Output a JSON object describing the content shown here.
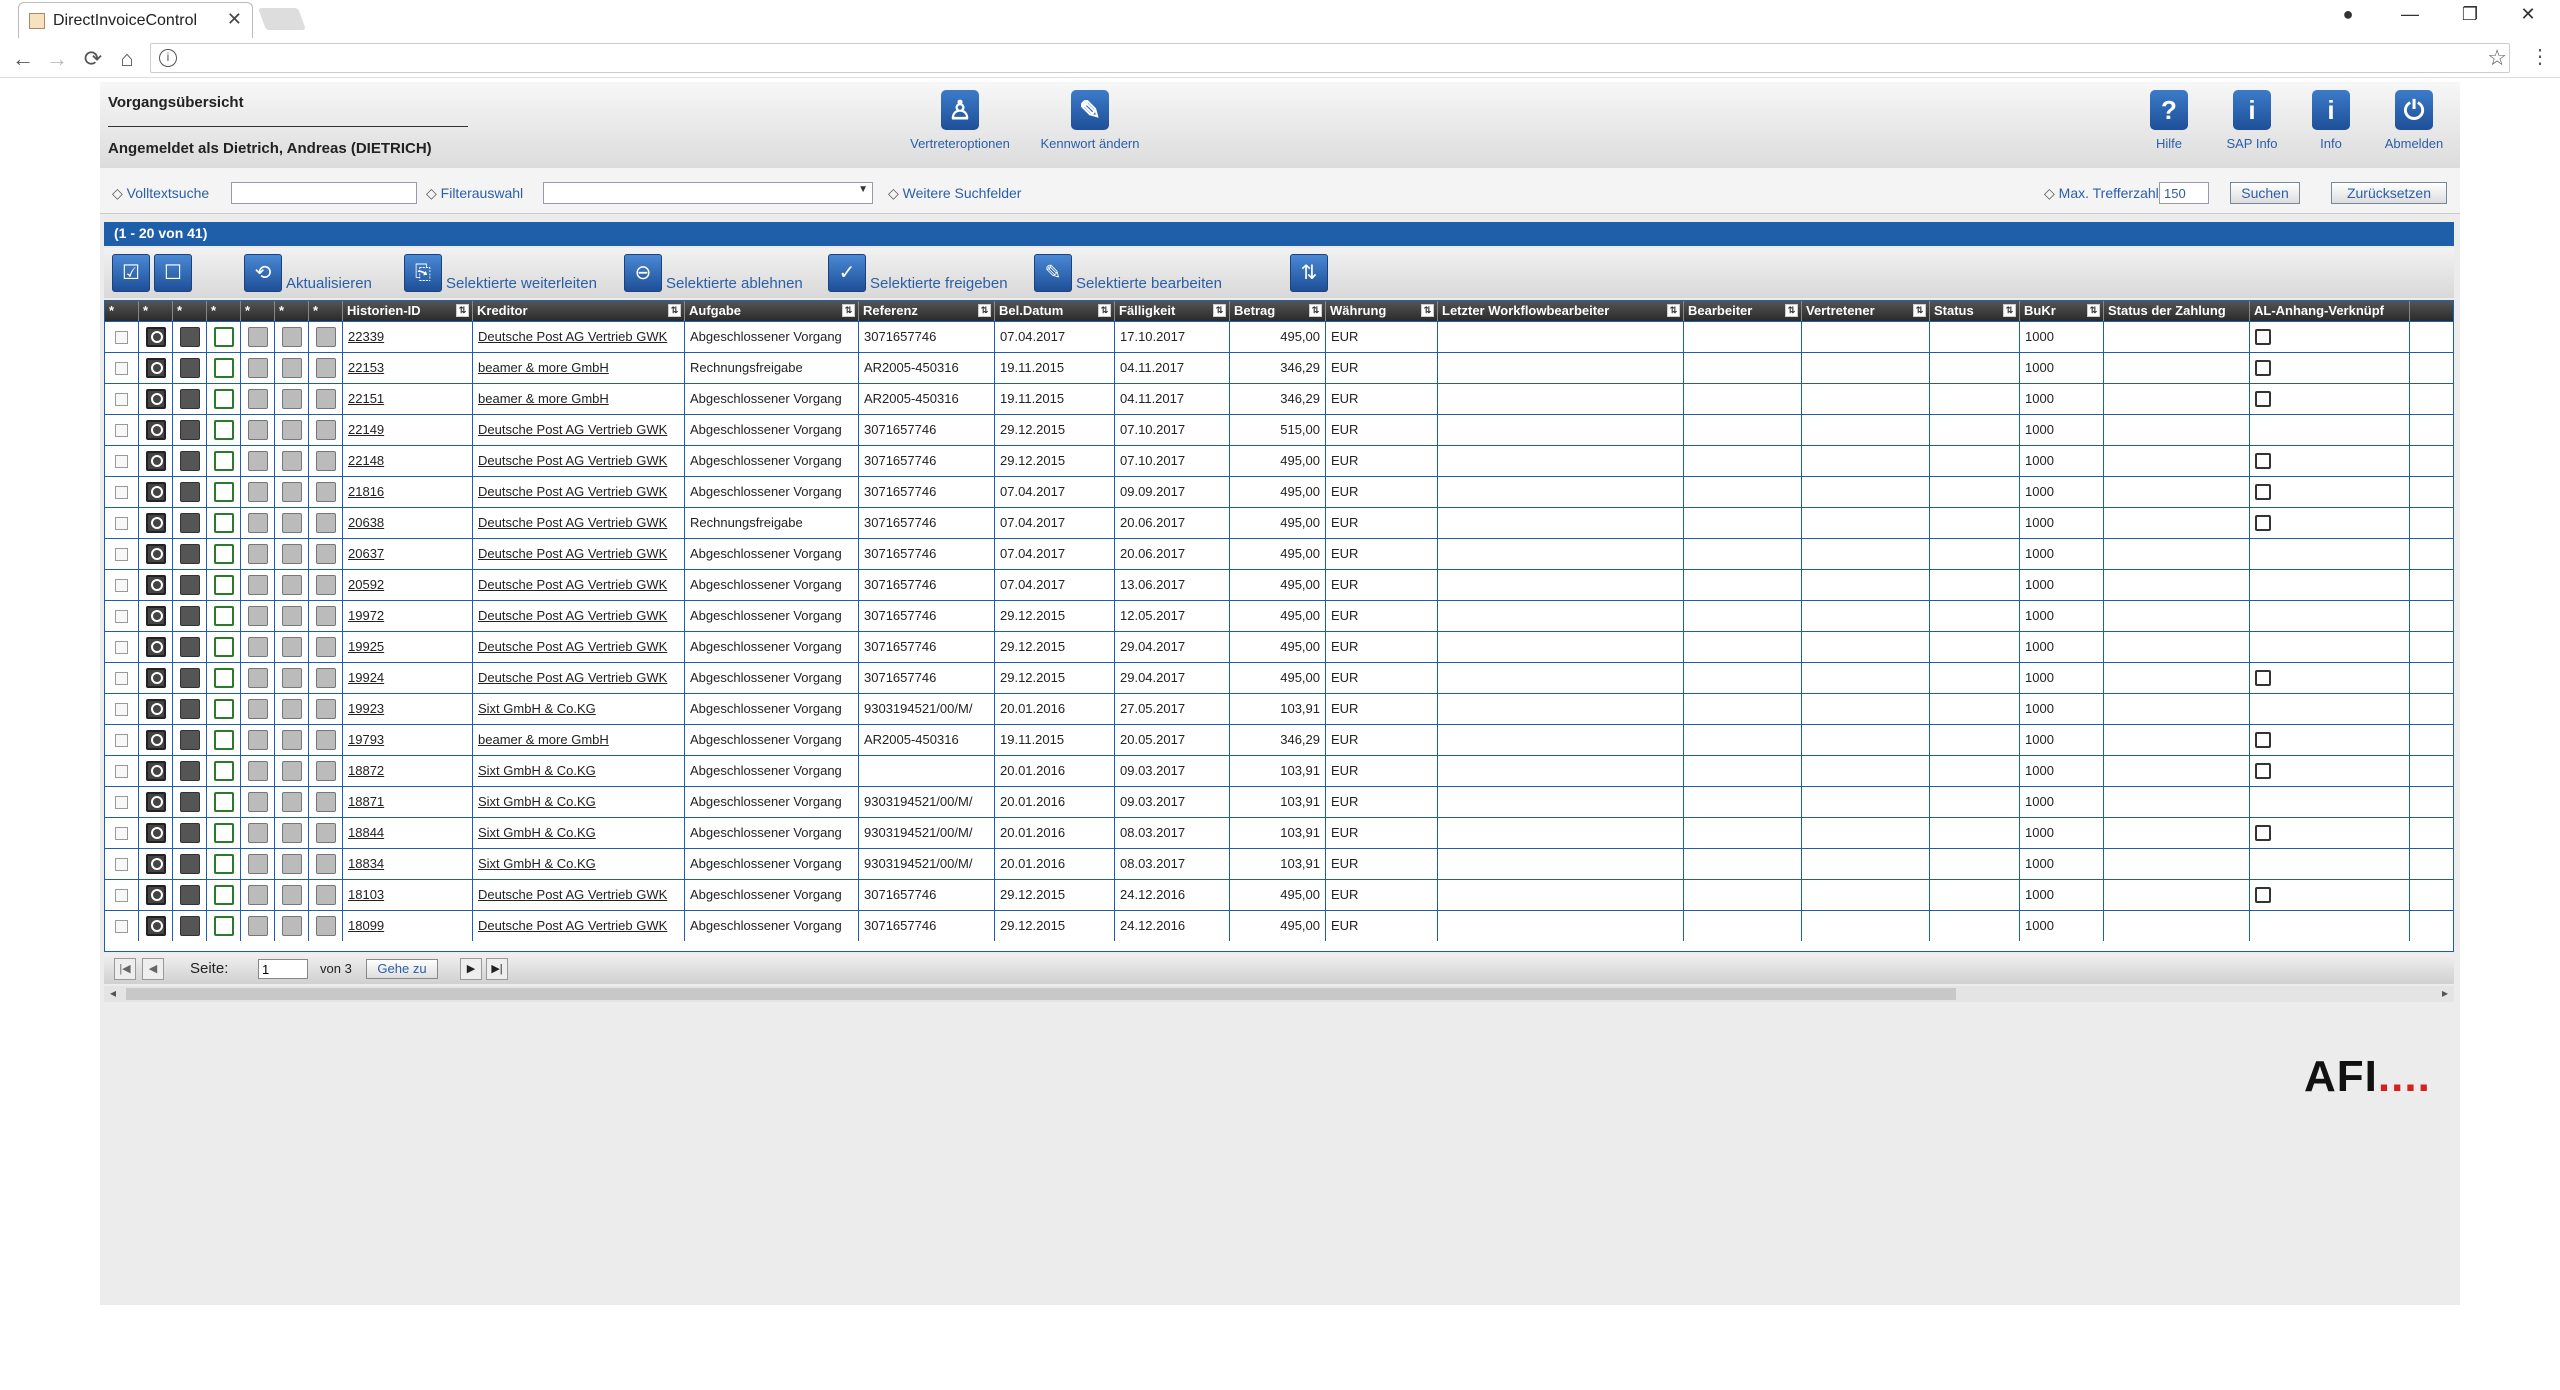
{
  "browser": {
    "tab_title": "DirectInvoiceControl",
    "tab_close": "✕",
    "nav": {
      "back": "←",
      "forward": "→",
      "reload": "⟳",
      "home": "⌂",
      "info": "i",
      "star": "☆",
      "menu": "⋮"
    },
    "window": {
      "profile": "●",
      "minimize": "—",
      "restore": "❐",
      "close": "✕"
    }
  },
  "header": {
    "title": "Vorgangsübersicht",
    "user": "Angemeldet als Dietrich, Andreas (DIETRICH)",
    "buttons": [
      {
        "label": "Vertreteroptionen",
        "icon": "person-icon",
        "glyph": "♙"
      },
      {
        "label": "Kennwort ändern",
        "icon": "key-pencil-icon",
        "glyph": "✎"
      },
      {
        "label": "Hilfe",
        "icon": "help-icon",
        "glyph": "?"
      },
      {
        "label": "SAP Info",
        "icon": "info-icon",
        "glyph": "i"
      },
      {
        "label": "Info",
        "icon": "info-icon",
        "glyph": "i"
      },
      {
        "label": "Abmelden",
        "icon": "power-icon",
        "glyph": "⏻"
      }
    ]
  },
  "search": {
    "fulltext_label": "Volltextsuche",
    "fulltext_value": "",
    "filter_label": "Filterauswahl",
    "filter_value": "",
    "more_label": "Weitere Suchfelder",
    "max_label": "Max. Trefferzahl",
    "max_value": "150",
    "search_btn": "Suchen",
    "reset_btn": "Zurücksetzen"
  },
  "count": "(1 - 20 von 41)",
  "toolbar": {
    "select_all_glyph": "☑",
    "deselect_glyph": "☐",
    "refresh": "Aktualisieren",
    "forward": "Selektierte weiterleiten",
    "reject": "Selektierte ablehnen",
    "release": "Selektierte freigeben",
    "edit": "Selektierte bearbeiten",
    "refresh_glyph": "⟲",
    "forward_glyph": "⎘",
    "reject_glyph": "⊖",
    "release_glyph": "✓",
    "edit_glyph": "✎",
    "extra_glyph": "⇅"
  },
  "columns": [
    "*",
    "*",
    "*",
    "*",
    "*",
    "*",
    "*",
    "Historien-ID",
    "Kreditor",
    "Aufgabe",
    "Referenz",
    "Bel.Datum",
    "Fälligkeit",
    "Betrag",
    "Währung",
    "Letzter Workflowbearbeiter",
    "Bearbeiter",
    "Vertretener",
    "Status",
    "BuKr",
    "Status der Zahlung",
    "AL-Anhang-Verknüpf"
  ],
  "rows": [
    {
      "id": "22339",
      "kreditor": "Deutsche Post AG Vertrieb GWK",
      "aufgabe": "Abgeschlossener Vorgang",
      "referenz": "3071657746",
      "bel": "07.04.2017",
      "faell": "17.10.2017",
      "betrag": "495,00",
      "waehrung": "EUR",
      "bukr": "1000",
      "anhang": true
    },
    {
      "id": "22153",
      "kreditor": "beamer & more GmbH",
      "aufgabe": "Rechnungsfreigabe",
      "referenz": "AR2005-450316",
      "bel": "19.11.2015",
      "faell": "04.11.2017",
      "betrag": "346,29",
      "waehrung": "EUR",
      "bukr": "1000",
      "anhang": true
    },
    {
      "id": "22151",
      "kreditor": "beamer & more GmbH",
      "aufgabe": "Abgeschlossener Vorgang",
      "referenz": "AR2005-450316",
      "bel": "19.11.2015",
      "faell": "04.11.2017",
      "betrag": "346,29",
      "waehrung": "EUR",
      "bukr": "1000",
      "anhang": true
    },
    {
      "id": "22149",
      "kreditor": "Deutsche Post AG Vertrieb GWK",
      "aufgabe": "Abgeschlossener Vorgang",
      "referenz": "3071657746",
      "bel": "29.12.2015",
      "faell": "07.10.2017",
      "betrag": "515,00",
      "waehrung": "EUR",
      "bukr": "1000",
      "anhang": false
    },
    {
      "id": "22148",
      "kreditor": "Deutsche Post AG Vertrieb GWK",
      "aufgabe": "Abgeschlossener Vorgang",
      "referenz": "3071657746",
      "bel": "29.12.2015",
      "faell": "07.10.2017",
      "betrag": "495,00",
      "waehrung": "EUR",
      "bukr": "1000",
      "anhang": true
    },
    {
      "id": "21816",
      "kreditor": "Deutsche Post AG Vertrieb GWK",
      "aufgabe": "Abgeschlossener Vorgang",
      "referenz": "3071657746",
      "bel": "07.04.2017",
      "faell": "09.09.2017",
      "betrag": "495,00",
      "waehrung": "EUR",
      "bukr": "1000",
      "anhang": true
    },
    {
      "id": "20638",
      "kreditor": "Deutsche Post AG Vertrieb GWK",
      "aufgabe": "Rechnungsfreigabe",
      "referenz": "3071657746",
      "bel": "07.04.2017",
      "faell": "20.06.2017",
      "betrag": "495,00",
      "waehrung": "EUR",
      "bukr": "1000",
      "anhang": true
    },
    {
      "id": "20637",
      "kreditor": "Deutsche Post AG Vertrieb GWK",
      "aufgabe": "Abgeschlossener Vorgang",
      "referenz": "3071657746",
      "bel": "07.04.2017",
      "faell": "20.06.2017",
      "betrag": "495,00",
      "waehrung": "EUR",
      "bukr": "1000",
      "anhang": false
    },
    {
      "id": "20592",
      "kreditor": "Deutsche Post AG Vertrieb GWK",
      "aufgabe": "Abgeschlossener Vorgang",
      "referenz": "3071657746",
      "bel": "07.04.2017",
      "faell": "13.06.2017",
      "betrag": "495,00",
      "waehrung": "EUR",
      "bukr": "1000",
      "anhang": false
    },
    {
      "id": "19972",
      "kreditor": "Deutsche Post AG Vertrieb GWK",
      "aufgabe": "Abgeschlossener Vorgang",
      "referenz": "3071657746",
      "bel": "29.12.2015",
      "faell": "12.05.2017",
      "betrag": "495,00",
      "waehrung": "EUR",
      "bukr": "1000",
      "anhang": false
    },
    {
      "id": "19925",
      "kreditor": "Deutsche Post AG Vertrieb GWK",
      "aufgabe": "Abgeschlossener Vorgang",
      "referenz": "3071657746",
      "bel": "29.12.2015",
      "faell": "29.04.2017",
      "betrag": "495,00",
      "waehrung": "EUR",
      "bukr": "1000",
      "anhang": false
    },
    {
      "id": "19924",
      "kreditor": "Deutsche Post AG Vertrieb GWK",
      "aufgabe": "Abgeschlossener Vorgang",
      "referenz": "3071657746",
      "bel": "29.12.2015",
      "faell": "29.04.2017",
      "betrag": "495,00",
      "waehrung": "EUR",
      "bukr": "1000",
      "anhang": true
    },
    {
      "id": "19923",
      "kreditor": "Sixt GmbH & Co.KG",
      "aufgabe": "Abgeschlossener Vorgang",
      "referenz": "9303194521/00/M/",
      "bel": "20.01.2016",
      "faell": "27.05.2017",
      "betrag": "103,91",
      "waehrung": "EUR",
      "bukr": "1000",
      "anhang": false
    },
    {
      "id": "19793",
      "kreditor": "beamer & more GmbH",
      "aufgabe": "Abgeschlossener Vorgang",
      "referenz": "AR2005-450316",
      "bel": "19.11.2015",
      "faell": "20.05.2017",
      "betrag": "346,29",
      "waehrung": "EUR",
      "bukr": "1000",
      "anhang": true
    },
    {
      "id": "18872",
      "kreditor": "Sixt GmbH & Co.KG",
      "aufgabe": "Abgeschlossener Vorgang",
      "referenz": "",
      "bel": "20.01.2016",
      "faell": "09.03.2017",
      "betrag": "103,91",
      "waehrung": "EUR",
      "bukr": "1000",
      "anhang": true
    },
    {
      "id": "18871",
      "kreditor": "Sixt GmbH & Co.KG",
      "aufgabe": "Abgeschlossener Vorgang",
      "referenz": "9303194521/00/M/",
      "bel": "20.01.2016",
      "faell": "09.03.2017",
      "betrag": "103,91",
      "waehrung": "EUR",
      "bukr": "1000",
      "anhang": false
    },
    {
      "id": "18844",
      "kreditor": "Sixt GmbH & Co.KG",
      "aufgabe": "Abgeschlossener Vorgang",
      "referenz": "9303194521/00/M/",
      "bel": "20.01.2016",
      "faell": "08.03.2017",
      "betrag": "103,91",
      "waehrung": "EUR",
      "bukr": "1000",
      "anhang": true
    },
    {
      "id": "18834",
      "kreditor": "Sixt GmbH & Co.KG",
      "aufgabe": "Abgeschlossener Vorgang",
      "referenz": "9303194521/00/M/",
      "bel": "20.01.2016",
      "faell": "08.03.2017",
      "betrag": "103,91",
      "waehrung": "EUR",
      "bukr": "1000",
      "anhang": false
    },
    {
      "id": "18103",
      "kreditor": "Deutsche Post AG Vertrieb GWK",
      "aufgabe": "Abgeschlossener Vorgang",
      "referenz": "3071657746",
      "bel": "29.12.2015",
      "faell": "24.12.2016",
      "betrag": "495,00",
      "waehrung": "EUR",
      "bukr": "1000",
      "anhang": true
    },
    {
      "id": "18099",
      "kreditor": "Deutsche Post AG Vertrieb GWK",
      "aufgabe": "Abgeschlossener Vorgang",
      "referenz": "3071657746",
      "bel": "29.12.2015",
      "faell": "24.12.2016",
      "betrag": "495,00",
      "waehrung": "EUR",
      "bukr": "1000",
      "anhang": false
    }
  ],
  "pager": {
    "label": "Seite:",
    "page": "1",
    "of": "von 3",
    "goto": "Gehe zu",
    "first": "|◀",
    "prev": "◀",
    "next": "▶",
    "last": "▶|"
  },
  "scroll": {
    "left": "◂",
    "right": "▸"
  },
  "logo": {
    "text": "AFI",
    "dots": "....",
    "colors": {
      "accent": "#1f5faa",
      "brand": "#d42020"
    }
  }
}
